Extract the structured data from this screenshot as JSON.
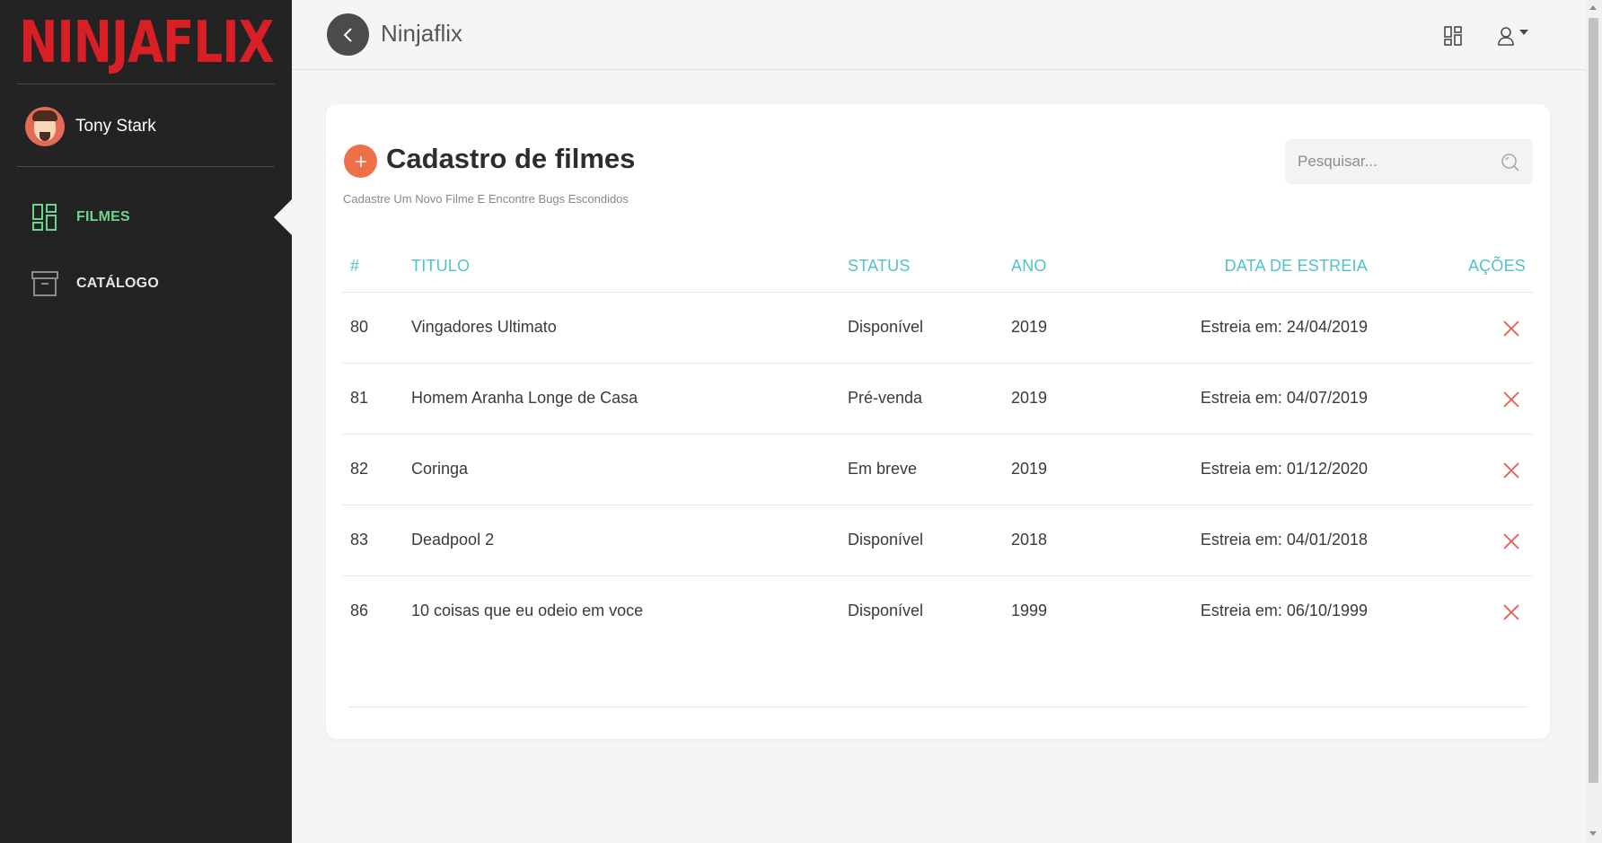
{
  "brand": {
    "logo_text": "NINJAFLIX",
    "logo_color": "#d81f26"
  },
  "user": {
    "name": "Tony Stark"
  },
  "sidebar": {
    "items": [
      {
        "label": "FILMES",
        "icon": "dashboard-icon",
        "active": true
      },
      {
        "label": "CATÁLOGO",
        "icon": "archive-icon",
        "active": false
      }
    ]
  },
  "topbar": {
    "title": "Ninjaflix",
    "back_icon": "chevron-left-icon",
    "grid_icon": "dashboard-icon",
    "user_icon": "user-icon"
  },
  "page": {
    "title": "Cadastro de filmes",
    "subtitle": "Cadastre Um Novo Filme E Encontre Bugs Escondidos",
    "search_placeholder": "Pesquisar..."
  },
  "table": {
    "headers": [
      "#",
      "TITULO",
      "STATUS",
      "ANO",
      "DATA DE ESTREIA",
      "AÇÕES"
    ],
    "rows": [
      {
        "id": "80",
        "title": "Vingadores Ultimato",
        "status": "Disponível",
        "year": "2019",
        "release": "Estreia em: 24/04/2019"
      },
      {
        "id": "81",
        "title": "Homem Aranha Longe de Casa",
        "status": "Pré-venda",
        "year": "2019",
        "release": "Estreia em: 04/07/2019"
      },
      {
        "id": "82",
        "title": "Coringa",
        "status": "Em breve",
        "year": "2019",
        "release": "Estreia em: 01/12/2020"
      },
      {
        "id": "83",
        "title": "Deadpool 2",
        "status": "Disponível",
        "year": "2018",
        "release": "Estreia em: 04/01/2018"
      },
      {
        "id": "86",
        "title": "10 coisas que eu odeio em voce",
        "status": "Disponível",
        "year": "1999",
        "release": "Estreia em: 06/10/1999"
      }
    ]
  },
  "colors": {
    "sidebar_bg": "#232323",
    "accent_green": "#6cd48d",
    "header_teal": "#4fc3c9",
    "add_orange": "#ee7049",
    "delete_red": "#e85a4f"
  }
}
